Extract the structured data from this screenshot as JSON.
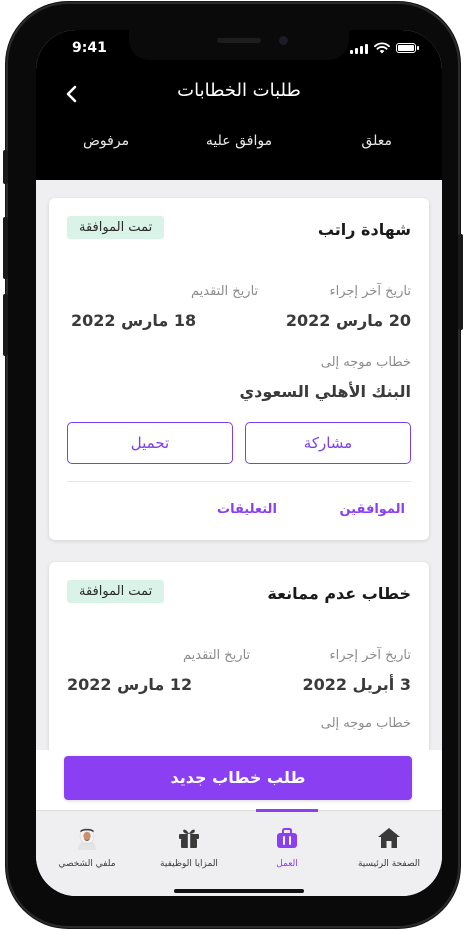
{
  "status_bar": {
    "time": "9:41"
  },
  "header": {
    "title": "طلبات الخطابات",
    "tabs": [
      {
        "label": "معلق"
      },
      {
        "label": "موافق عليه"
      },
      {
        "label": "مرفوض"
      }
    ]
  },
  "requests": [
    {
      "title": "شهادة راتب",
      "status": "تمت الموافقة",
      "last_action_label": "تاريخ آخر إجراء",
      "last_action_date": "20 مارس 2022",
      "submit_label": "تاريخ التقديم",
      "submit_date": "18 مارس 2022",
      "addressed_to_label": "خطاب موجه إلى",
      "addressed_to": "البنك الأهلي السعودي",
      "share_label": "مشاركة",
      "download_label": "تحميل",
      "approvers_label": "الموافقين",
      "comments_label": "التعليقات"
    },
    {
      "title": "خطاب عدم ممانعة",
      "status": "تمت الموافقة",
      "last_action_label": "تاريخ آخر إجراء",
      "last_action_date": "3 أبريل 2022",
      "submit_label": "تاريخ التقديم",
      "submit_date": "12 مارس 2022",
      "addressed_to_label": "خطاب موجه إلى"
    }
  ],
  "cta": {
    "label": "طلب خطاب جديد"
  },
  "bottom_nav": [
    {
      "label": "الصفحة الرئيسية",
      "icon": "home-icon"
    },
    {
      "label": "العمل",
      "icon": "briefcase-icon",
      "active": true
    },
    {
      "label": "المزايا الوظيفية",
      "icon": "gift-icon"
    },
    {
      "label": "ملفي الشخصي",
      "icon": "avatar-icon"
    }
  ],
  "colors": {
    "accent": "#8a3ff2",
    "badge_bg": "#d9f3e8",
    "header_bg": "#000000"
  }
}
